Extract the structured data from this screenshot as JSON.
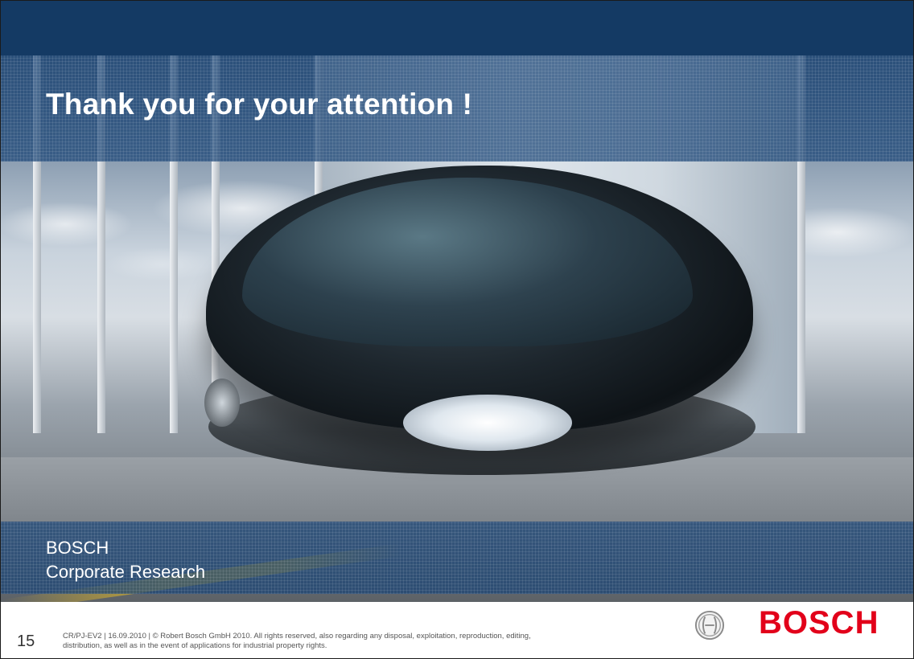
{
  "slide": {
    "title": "Thank you for your attention !",
    "subtitle_lines": [
      "BOSCH",
      "Corporate Research"
    ]
  },
  "footer": {
    "page_number": "15",
    "legal_line_1": "CR/PJ-EV2 | 16.09.2010 | © Robert Bosch GmbH 2010. All rights reserved, also regarding any disposal, exploitation, reproduction, editing,",
    "legal_line_2": "distribution, as well as in the event of applications for industrial property rights.",
    "logo_word": "BOSCH"
  },
  "colors": {
    "header_blue": "#143a64",
    "band_blue": "#194476",
    "logo_red": "#e2001a"
  },
  "icons": {
    "background_image": "concept-car-photo",
    "logo_mark": "bosch-armature-icon"
  }
}
